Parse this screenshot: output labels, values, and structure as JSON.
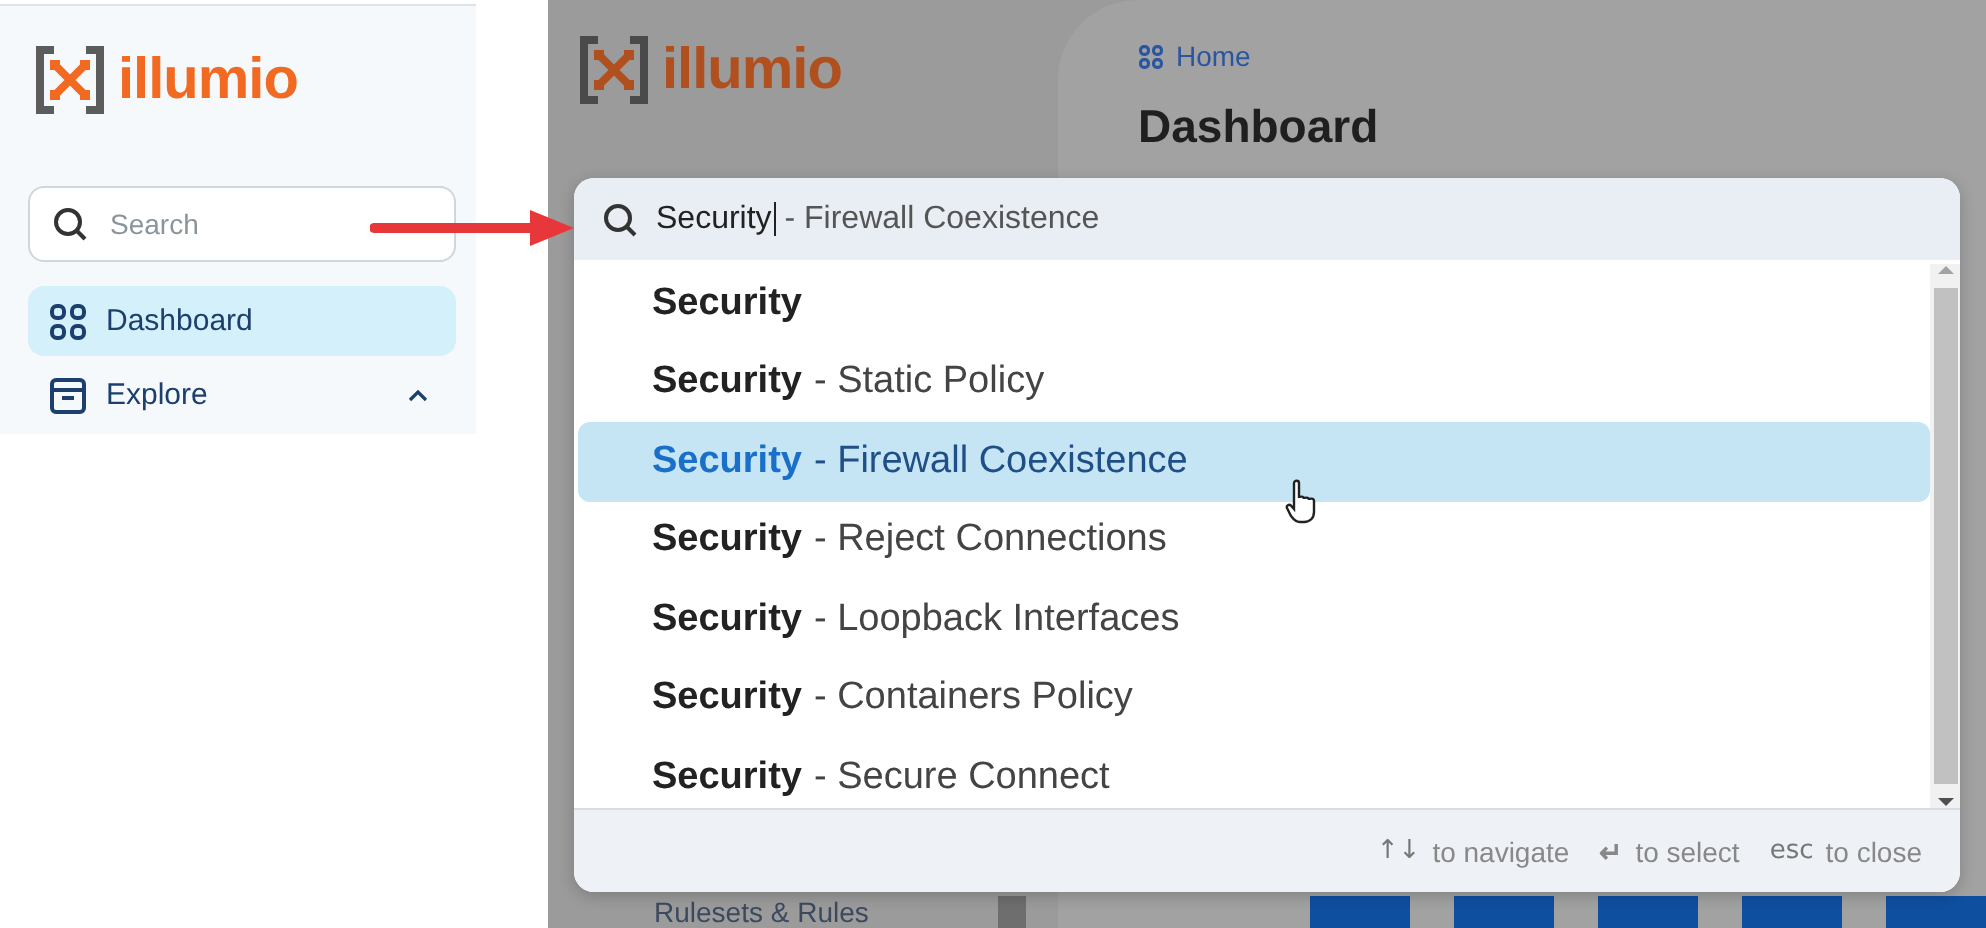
{
  "left_panel": {
    "brand": "illumio",
    "search": {
      "placeholder": "Search"
    },
    "nav": [
      {
        "label": "Dashboard",
        "selected": true,
        "kind": "grid"
      },
      {
        "label": "Explore",
        "selected": false,
        "kind": "box",
        "expanded": true
      }
    ]
  },
  "background_app": {
    "brand": "illumio",
    "breadcrumb": "Home",
    "page_title": "Dashboard",
    "sidebar_item": "Rulesets & Rules"
  },
  "search_dialog": {
    "query": "Security",
    "suggestion": "- Firewall Coexistence",
    "results": [
      {
        "match": "Security",
        "selected": false
      },
      {
        "match": "Security",
        "rest": "- Static Policy",
        "selected": false
      },
      {
        "match": "Security",
        "rest": "- Firewall Coexistence",
        "selected": true
      },
      {
        "match": "Security",
        "rest": "- Reject Connections",
        "selected": false
      },
      {
        "match": "Security",
        "rest": "- Loopback Interfaces",
        "selected": false
      },
      {
        "match": "Security",
        "rest": "- Containers Policy",
        "selected": false
      },
      {
        "match": "Security",
        "rest": "- Secure Connect",
        "selected": false
      }
    ],
    "hints": [
      {
        "keys": "↑↓",
        "label": "to navigate"
      },
      {
        "keys": "↵",
        "label": "to select"
      },
      {
        "keys": "esc",
        "label": "to close"
      }
    ]
  }
}
